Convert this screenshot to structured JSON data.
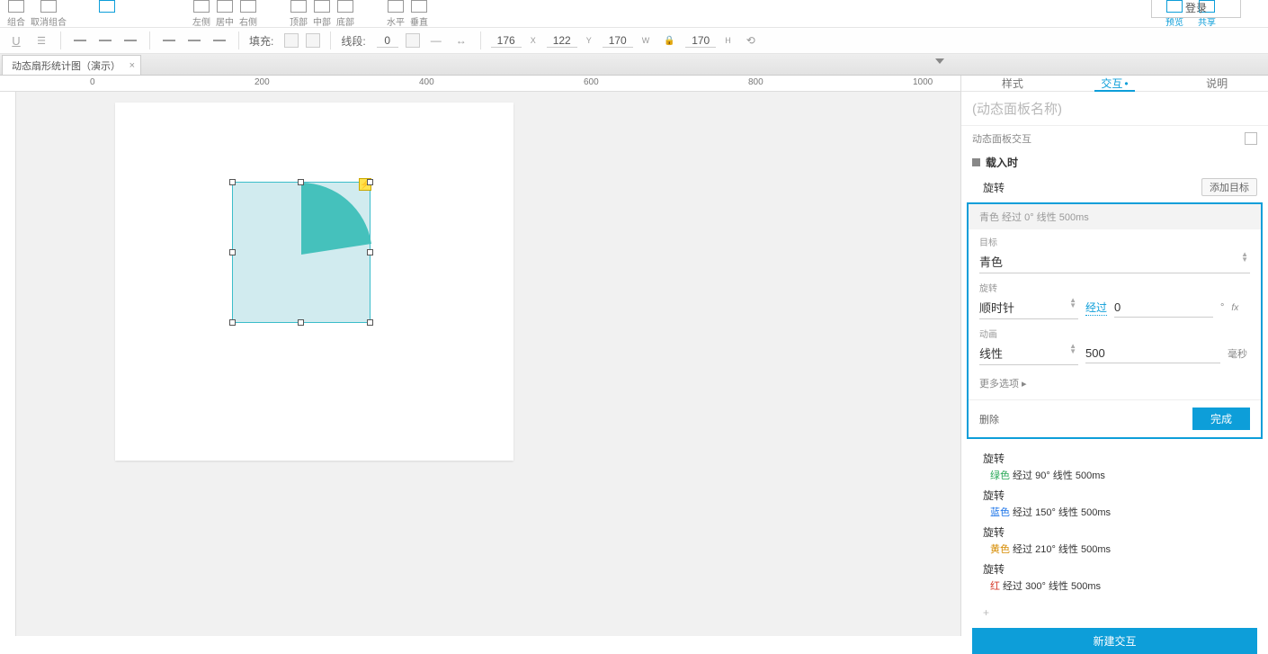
{
  "toolbar": {
    "group": "组合",
    "ungroup": "取消组合",
    "zoom": "",
    "left": "左侧",
    "center": "居中",
    "right": "右侧",
    "top": "顶部",
    "middle": "中部",
    "bottom": "底部",
    "horizontal": "水平",
    "vertical": "垂直",
    "preview": "预览",
    "share": "共享",
    "login": "登录"
  },
  "subbar": {
    "fill_label": "填充:",
    "line_label": "线段:",
    "line_val": "0",
    "x": "176",
    "y": "122",
    "w": "170",
    "h": "170"
  },
  "tab": {
    "title": "动态扇形统计图（演示）"
  },
  "ruler": {
    "ticks": [
      "0",
      "200",
      "400",
      "600",
      "800",
      "1000"
    ]
  },
  "panel": {
    "tabs": {
      "style": "样式",
      "interaction": "交互",
      "note": "说明"
    },
    "title_placeholder": "(动态面板名称)",
    "section": "动态面板交互",
    "event": "载入时",
    "action_name": "旋转",
    "add_target": "添加目标",
    "summary": "青色 经过 0° 线性 500ms",
    "target_label": "目标",
    "target_value": "青色",
    "rotate_label": "旋转",
    "direction_value": "顺时针",
    "via_label": "经过",
    "degree_value": "0",
    "anim_label": "动画",
    "easing_value": "线性",
    "duration_value": "500",
    "duration_unit": "毫秒",
    "more": "更多选项 ▸",
    "delete": "删除",
    "done": "完成",
    "others": [
      {
        "title": "旋转",
        "color": "绿色",
        "cls": "c-green",
        "desc": "经过 90° 线性 500ms"
      },
      {
        "title": "旋转",
        "color": "蓝色",
        "cls": "c-blue",
        "desc": "经过 150° 线性 500ms"
      },
      {
        "title": "旋转",
        "color": "黄色",
        "cls": "c-yellow",
        "desc": "经过 210° 线性 500ms"
      },
      {
        "title": "旋转",
        "color": "红",
        "cls": "c-red",
        "desc": "经过 300° 线性 500ms"
      }
    ],
    "new_interaction": "新建交互"
  }
}
